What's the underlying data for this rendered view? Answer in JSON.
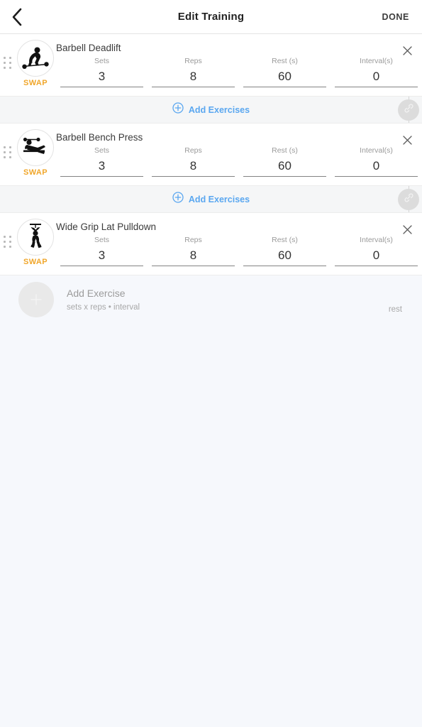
{
  "header": {
    "back_icon": "chevron-left-icon",
    "title": "Edit Training",
    "done_label": "DONE"
  },
  "field_labels": {
    "sets": "Sets",
    "reps": "Reps",
    "rest": "Rest (s)",
    "interval": "Interval(s)"
  },
  "swap_label": "SWAP",
  "divider": {
    "add_exercises_label": "Add Exercises",
    "plus_icon": "circled-plus-icon",
    "link_icon": "chain-link-icon"
  },
  "exercises": [
    {
      "name": "Barbell Deadlift",
      "thumb_icon": "deadlift-silhouette-icon",
      "sets": "3",
      "reps": "8",
      "rest": "60",
      "interval": "0"
    },
    {
      "name": "Barbell Bench Press",
      "thumb_icon": "bench-press-silhouette-icon",
      "sets": "3",
      "reps": "8",
      "rest": "60",
      "interval": "0"
    },
    {
      "name": "Wide Grip Lat Pulldown",
      "thumb_icon": "lat-pulldown-silhouette-icon",
      "sets": "3",
      "reps": "8",
      "rest": "60",
      "interval": "0"
    }
  ],
  "add_exercise": {
    "plus_icon": "plus-icon",
    "title": "Add Exercise",
    "subtitle": "sets x reps • interval",
    "rest_label": "rest"
  },
  "colors": {
    "accent_blue": "#5aa7f0",
    "swap_orange": "#f0a62a",
    "page_bg": "#f6f8fc",
    "band_bg": "#f5f6f7"
  }
}
